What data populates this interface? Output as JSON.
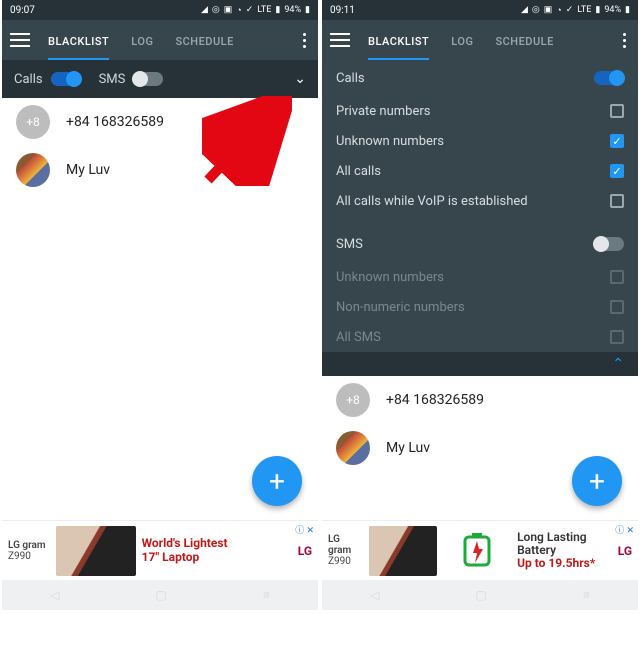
{
  "status": {
    "time_left": "09:07",
    "time_right": "09:11",
    "battery": "94%"
  },
  "tabs": {
    "blacklist": "BLACKLIST",
    "log": "LOG",
    "schedule": "SCHEDULE"
  },
  "quick": {
    "calls": "Calls",
    "sms": "SMS"
  },
  "panel": {
    "calls_header": "Calls",
    "private_numbers": "Private numbers",
    "unknown_numbers": "Unknown numbers",
    "all_calls": "All calls",
    "voip": "All calls while VoIP is established",
    "sms_header": "SMS",
    "sms_unknown": "Unknown numbers",
    "sms_nonnumeric": "Non-numeric numbers",
    "sms_all": "All SMS"
  },
  "contacts": {
    "plus8": "+8",
    "phone": "+84 168326589",
    "myluv": "My Luv"
  },
  "ad_left": {
    "brand": "LG gram",
    "model": "Z990",
    "line1": "World's Lightest",
    "line2": "17\" Laptop",
    "lg": "LG"
  },
  "ad_right": {
    "brand": "LG gram",
    "model": "Z990",
    "line1": "Long Lasting Battery",
    "line2": "Up to 19.5hrs*",
    "lg": "LG"
  },
  "ad_badge": "ⓘ ✕"
}
